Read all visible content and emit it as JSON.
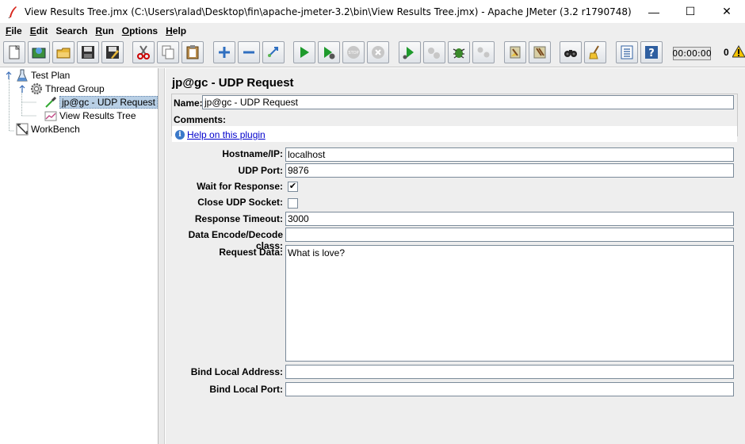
{
  "window": {
    "title": "View Results Tree.jmx (C:\\Users\\ralad\\Desktop\\fin\\apache-jmeter-3.2\\bin\\View Results Tree.jmx) - Apache JMeter (3.2 r1790748)",
    "controls": {
      "minimize": "—",
      "maximize": "☐",
      "close": "✕"
    }
  },
  "menu": [
    {
      "mnemonic": "F",
      "rest": "ile"
    },
    {
      "mnemonic": "E",
      "rest": "dit"
    },
    {
      "mnemonic": "",
      "rest": "Search"
    },
    {
      "mnemonic": "R",
      "rest": "un"
    },
    {
      "mnemonic": "O",
      "rest": "ptions"
    },
    {
      "mnemonic": "H",
      "rest": "elp"
    }
  ],
  "toolbar": {
    "timer": "00:00:00",
    "error_count": "0",
    "buttons": [
      "new-icon",
      "templates-icon",
      "open-icon",
      "save-icon",
      "save-as-icon",
      "cut-icon",
      "copy-icon",
      "paste-icon",
      "expand-icon",
      "collapse-icon",
      "toggle-icon",
      "start-icon",
      "start-no-pauses-icon",
      "stop-icon",
      "shutdown-icon",
      "remote-start-icon",
      "remote-stop-icon",
      "remote-exit-icon",
      "clear-icon",
      "clear-all-icon",
      "search-icon",
      "reset-search-icon",
      "function-helper-icon",
      "help-icon"
    ]
  },
  "tree": {
    "items": [
      {
        "label": "Test Plan",
        "icon": "test-plan-icon"
      },
      {
        "label": "Thread Group",
        "icon": "thread-group-icon"
      },
      {
        "label": "jp@gc - UDP Request",
        "icon": "udp-sampler-icon",
        "selected": true
      },
      {
        "label": "View Results Tree",
        "icon": "listener-icon"
      },
      {
        "label": "WorkBench",
        "icon": "workbench-icon"
      }
    ]
  },
  "panel": {
    "title": "jp@gc - UDP Request",
    "name_label": "Name:",
    "name_value": "jp@gc - UDP Request",
    "comments_label": "Comments:",
    "help_link": "Help on this plugin",
    "fields": {
      "hostname_label": "Hostname/IP:",
      "hostname_value": "localhost",
      "port_label": "UDP Port:",
      "port_value": "9876",
      "wait_label": "Wait for Response:",
      "wait_checked": true,
      "close_label": "Close UDP Socket:",
      "close_checked": false,
      "timeout_label": "Response Timeout:",
      "timeout_value": "3000",
      "encode_label": "Data Encode/Decode class:",
      "encode_value": "",
      "request_label": "Request Data:",
      "request_value": "What is love?",
      "bind_addr_label": "Bind Local Address:",
      "bind_addr_value": "",
      "bind_port_label": "Bind Local Port:",
      "bind_port_value": ""
    }
  },
  "colors": {
    "selection": "#b8cfe5",
    "link": "#0000cc",
    "panel_bg": "#eeeeee"
  }
}
